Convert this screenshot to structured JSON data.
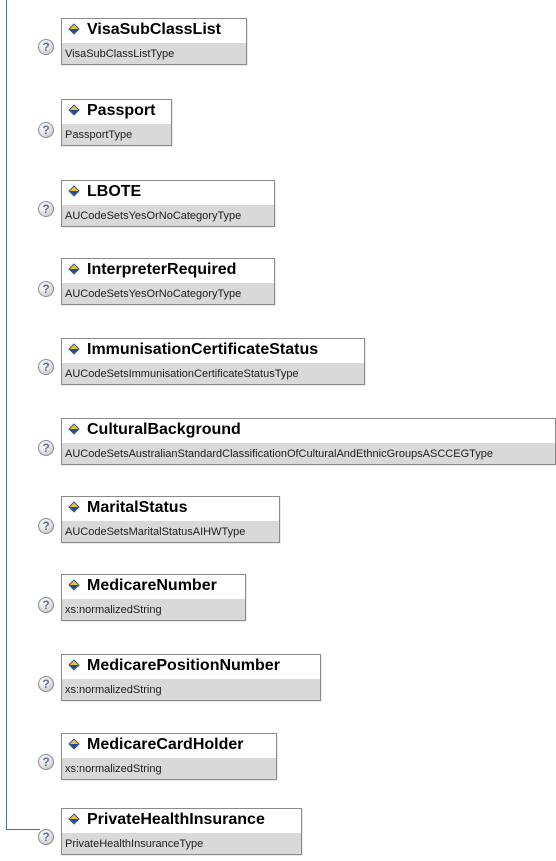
{
  "diagram": {
    "items": [
      {
        "name": "VisaSubClassList",
        "type": "VisaSubClassListType"
      },
      {
        "name": "Passport",
        "type": "PassportType"
      },
      {
        "name": "LBOTE",
        "type": "AUCodeSetsYesOrNoCategoryType"
      },
      {
        "name": "InterpreterRequired",
        "type": "AUCodeSetsYesOrNoCategoryType"
      },
      {
        "name": "ImmunisationCertificateStatus",
        "type": "AUCodeSetsImmunisationCertificateStatusType"
      },
      {
        "name": "CulturalBackground",
        "type": "AUCodeSetsAustralianStandardClassificationOfCulturalAndEthnicGroupsASCCEGType"
      },
      {
        "name": "MaritalStatus",
        "type": "AUCodeSetsMaritalStatusAIHWType"
      },
      {
        "name": "MedicareNumber",
        "type": "xs:normalizedString"
      },
      {
        "name": "MedicarePositionNumber",
        "type": "xs:normalizedString"
      },
      {
        "name": "MedicareCardHolder",
        "type": "xs:normalizedString"
      },
      {
        "name": "PrivateHealthInsurance",
        "type": "PrivateHealthInsuranceType"
      }
    ],
    "help_icon_symbol": "?"
  }
}
